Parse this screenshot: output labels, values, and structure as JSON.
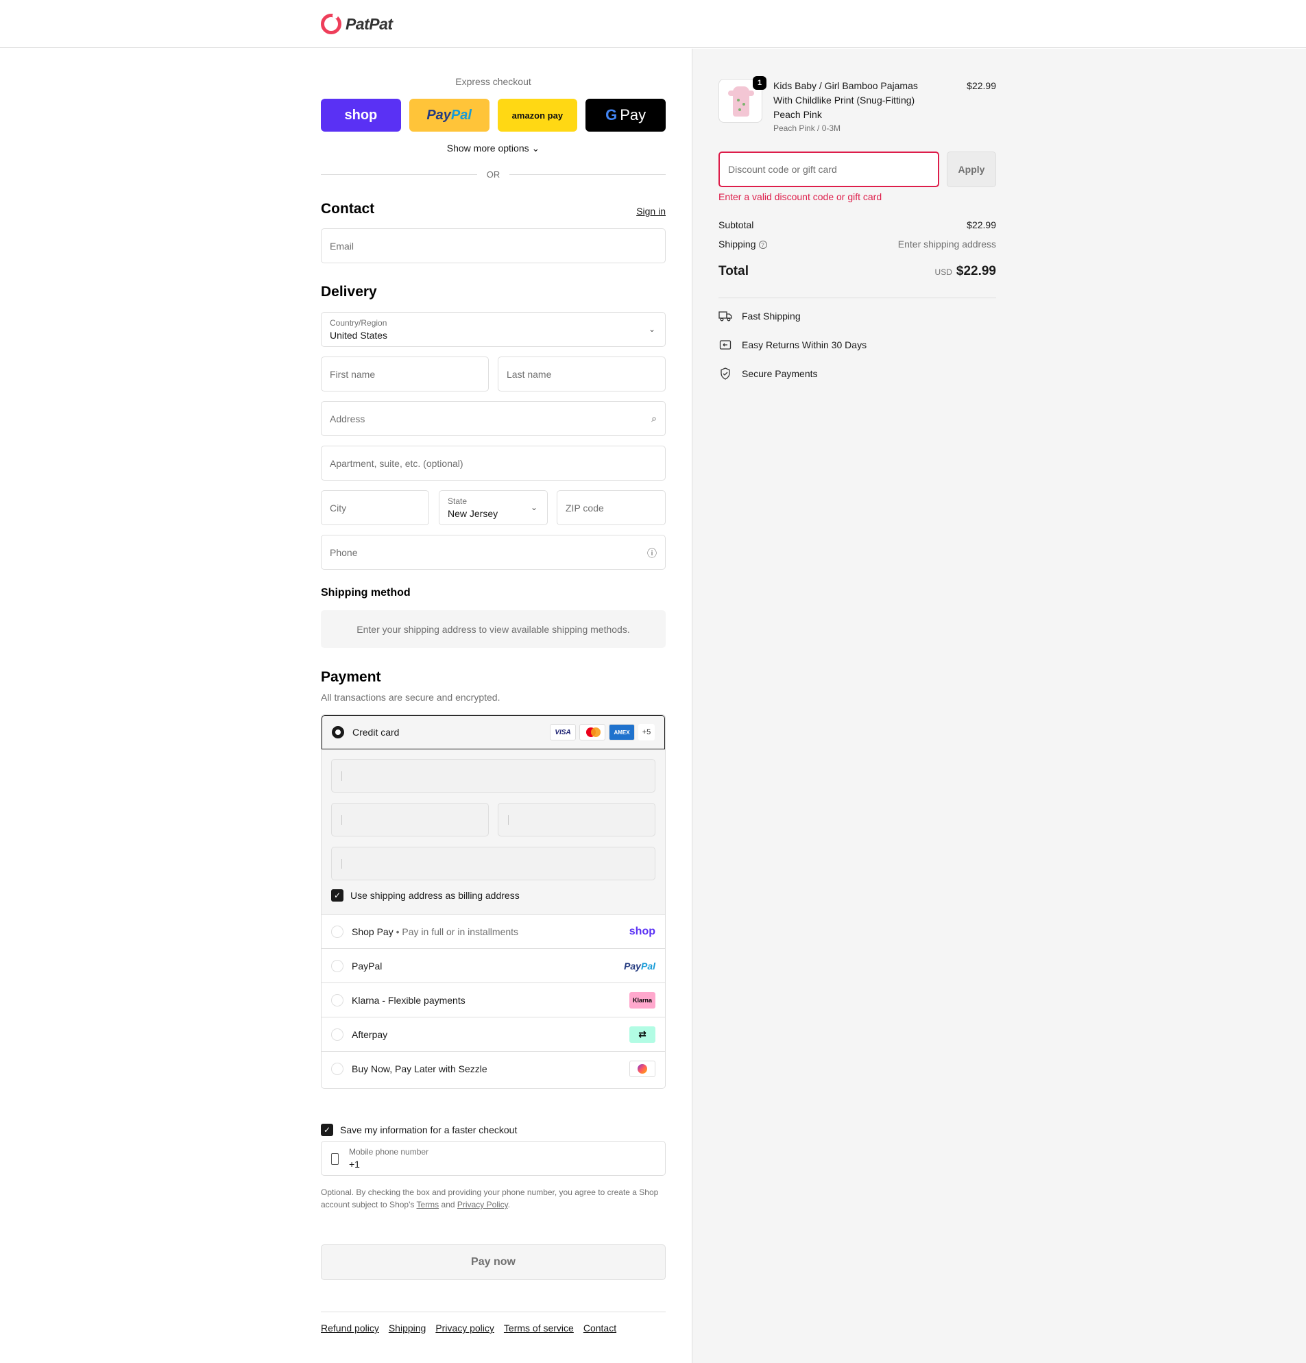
{
  "brand": {
    "name": "PatPat",
    "accent": "#ee3e5a"
  },
  "express": {
    "title": "Express checkout",
    "shop_label": "shop",
    "paypal_label_a": "Pay",
    "paypal_label_b": "Pal",
    "amazon_label": "amazon pay",
    "gpay_g": "G",
    "gpay_label": "Pay",
    "show_more": "Show more options",
    "or_label": "OR"
  },
  "contact": {
    "title": "Contact",
    "sign_in": "Sign in",
    "email_placeholder": "Email"
  },
  "delivery": {
    "title": "Delivery",
    "country_label": "Country/Region",
    "country_value": "United States",
    "first_name_placeholder": "First name",
    "last_name_placeholder": "Last name",
    "address_placeholder": "Address",
    "apartment_placeholder": "Apartment, suite, etc. (optional)",
    "city_placeholder": "City",
    "state_label": "State",
    "state_value": "New Jersey",
    "zip_placeholder": "ZIP code",
    "phone_placeholder": "Phone"
  },
  "shipping_method": {
    "title": "Shipping method",
    "info": "Enter your shipping address to view available shipping methods."
  },
  "payment": {
    "title": "Payment",
    "subtitle": "All transactions are secure and encrypted.",
    "credit_card_label": "Credit card",
    "card_logos": [
      "VISA",
      "AMEX"
    ],
    "more_cards": "+5",
    "billing_label": "Use shipping address as billing address",
    "methods": [
      {
        "label": "Shop Pay",
        "sub": "Pay in full or in installments",
        "logo": "shop"
      },
      {
        "label": "PayPal",
        "logo_a": "Pay",
        "logo_b": "Pal"
      },
      {
        "label": "Klarna - Flexible payments",
        "logo": "Klarna"
      },
      {
        "label": "Afterpay",
        "logo": "afterpay-icon"
      },
      {
        "label": "Buy Now, Pay Later with Sezzle",
        "logo": "sezzle-icon"
      }
    ]
  },
  "save_info": {
    "label": "Save my information for a faster checkout",
    "mobile_label": "Mobile phone number",
    "mobile_value": "+1",
    "legal_a": "Optional. By checking the box and providing your phone number, you agree to create a Shop account subject to Shop's",
    "terms": "Terms",
    "legal_and": "and",
    "privacy": "Privacy Policy",
    "legal_end": "."
  },
  "pay_now": "Pay now",
  "footer": [
    "Refund policy",
    "Shipping",
    "Privacy policy",
    "Terms of service",
    "Contact"
  ],
  "summary": {
    "item_name": "Kids Baby / Girl Bamboo Pajamas With Childlike Print (Snug-Fitting) Peach Pink",
    "item_variant": "Peach Pink / 0-3M",
    "item_price": "$22.99",
    "quantity": "1",
    "discount_placeholder": "Discount code or gift card",
    "apply_label": "Apply",
    "discount_error": "Enter a valid discount code or gift card",
    "subtotal_label": "Subtotal",
    "subtotal_value": "$22.99",
    "shipping_label": "Shipping",
    "shipping_value": "Enter shipping address",
    "total_label": "Total",
    "currency": "USD",
    "total_value": "$22.99",
    "perks": [
      "Fast Shipping",
      "Easy Returns Within 30 Days",
      "Secure Payments"
    ]
  }
}
